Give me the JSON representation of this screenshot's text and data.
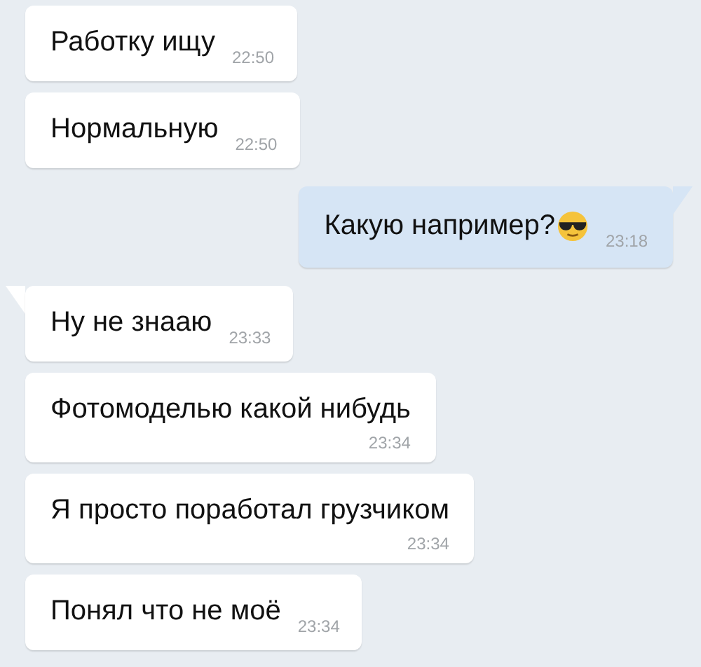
{
  "messages": [
    {
      "outgoing": false,
      "text": "Работку ищу",
      "time": "22:50",
      "tail": false,
      "kind": "inline",
      "emoji": false
    },
    {
      "outgoing": false,
      "text": "Нормальную",
      "time": "22:50",
      "tail": false,
      "kind": "inline",
      "emoji": false
    },
    {
      "outgoing": true,
      "text": "Какую например?",
      "time": "23:18",
      "tail": true,
      "kind": "inline",
      "emoji": true
    },
    {
      "outgoing": false,
      "text": "Ну не знааю",
      "time": "23:33",
      "tail": true,
      "kind": "inline",
      "emoji": false
    },
    {
      "outgoing": false,
      "text": "Фотомоделью какой нибудь",
      "time": "23:34",
      "tail": false,
      "kind": "stacked",
      "emoji": false
    },
    {
      "outgoing": false,
      "text": "Я просто поработал грузчиком",
      "time": "23:34",
      "tail": false,
      "kind": "stacked",
      "emoji": false
    },
    {
      "outgoing": false,
      "text": "Понял что не моё",
      "time": "23:34",
      "tail": false,
      "kind": "inline",
      "emoji": false
    }
  ]
}
